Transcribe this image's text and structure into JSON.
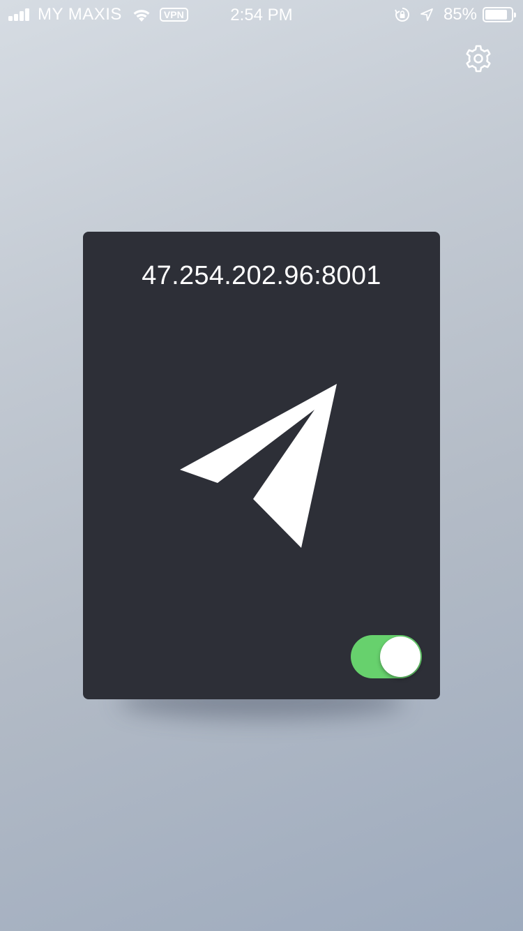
{
  "status_bar": {
    "carrier": "MY MAXIS",
    "vpn_label": "VPN",
    "time": "2:54 PM",
    "battery_percent": "85%",
    "battery_level": 0.85,
    "icons": [
      "signal-icon",
      "wifi-icon",
      "vpn-badge",
      "rotation-lock-icon",
      "location-arrow-icon",
      "battery-icon"
    ]
  },
  "settings": {
    "icon": "gear-icon"
  },
  "card": {
    "server_address": "47.254.202.96:8001",
    "icon": "paper-plane-icon",
    "toggle_on": true,
    "toggle_color": "#67d16d",
    "background_color": "#2d2f37"
  }
}
